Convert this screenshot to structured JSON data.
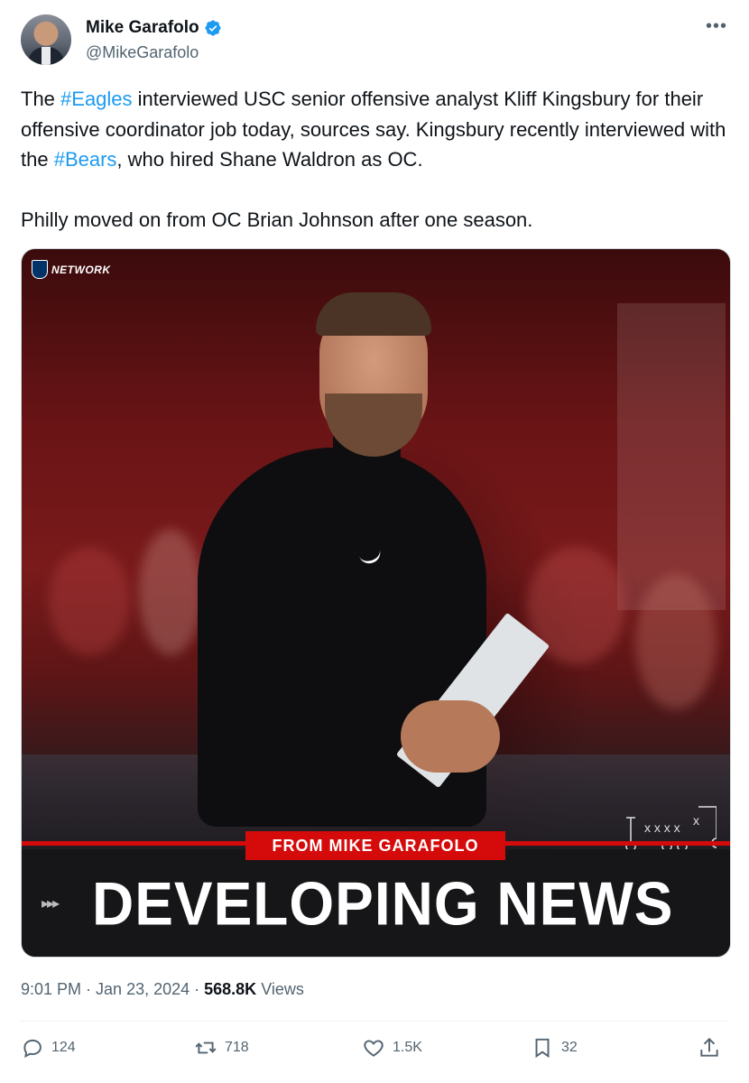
{
  "author": {
    "name": "Mike Garafolo",
    "handle": "@MikeGarafolo",
    "verified": true
  },
  "tweet": {
    "p1_a": "The ",
    "p1_tag1": "#Eagles",
    "p1_b": " interviewed USC senior offensive analyst Kliff Kingsbury for their offensive coordinator job today, sources say. Kingsbury recently interviewed with the ",
    "p1_tag2": "#Bears",
    "p1_c": ", who hired Shane Waldron as OC.",
    "p2": "Philly moved on from OC Brian Johnson after one season."
  },
  "media": {
    "network_label": "NETWORK",
    "badge": "FROM MIKE GARAFOLO",
    "headline": "DEVELOPING NEWS",
    "arrows": "▸▸▸",
    "accent": "#d50a0a"
  },
  "meta": {
    "time": "9:01 PM",
    "sep1": " · ",
    "date": "Jan 23, 2024",
    "sep2": " · ",
    "views": "568.8K",
    "views_label": " Views"
  },
  "actions": {
    "replies": "124",
    "reposts": "718",
    "likes": "1.5K",
    "bookmarks": "32"
  },
  "colors": {
    "link": "#1d9bf0",
    "muted": "#536471"
  }
}
